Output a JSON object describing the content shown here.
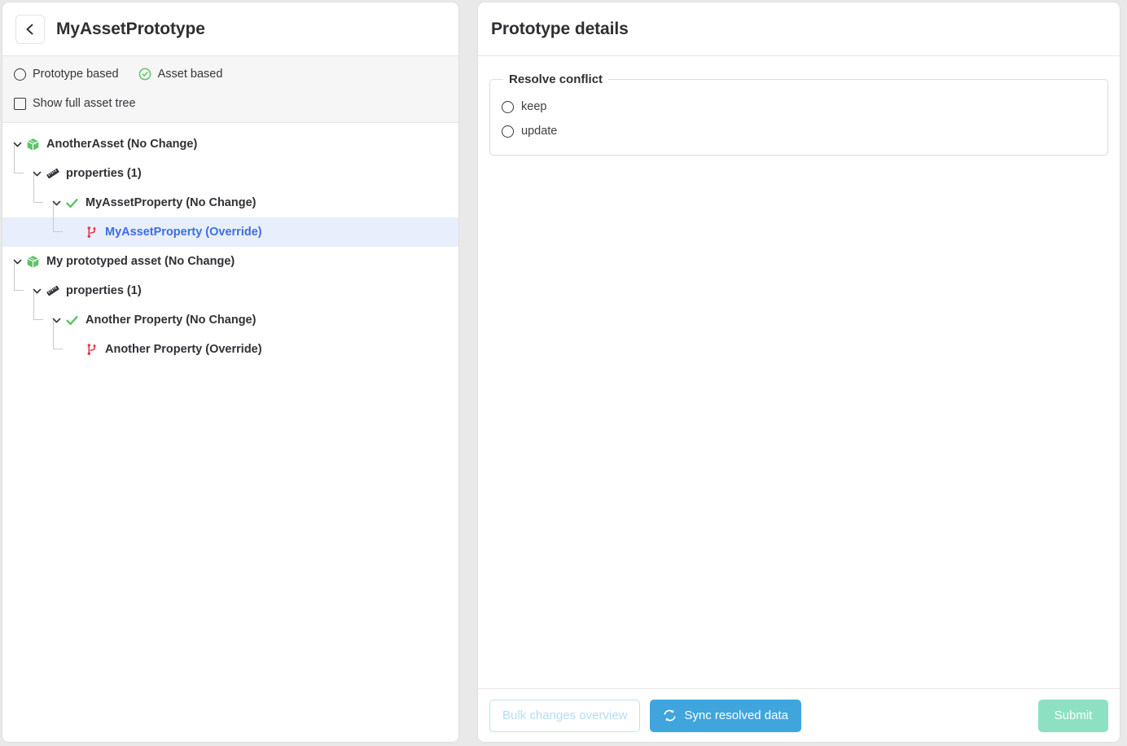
{
  "left_panel": {
    "back_button_icon": "chevron-left-icon",
    "title": "MyAssetPrototype",
    "toolbar": {
      "prototype_based_label": "Prototype based",
      "prototype_based_selected": false,
      "asset_based_label": "Asset based",
      "asset_based_selected": true,
      "show_full_asset_tree_label": "Show full asset tree",
      "show_full_asset_tree_checked": false
    },
    "tree": [
      {
        "label": "AnotherAsset (No Change)",
        "depth": 0,
        "icon": "green-cube-icon",
        "expanded": true,
        "selected": false
      },
      {
        "label": "properties (1)",
        "depth": 1,
        "icon": "ruler-icon",
        "expanded": true,
        "selected": false
      },
      {
        "label": "MyAssetProperty (No Change)",
        "depth": 2,
        "icon": "green-check-icon",
        "expanded": true,
        "selected": false
      },
      {
        "label": "MyAssetProperty (Override)",
        "depth": 3,
        "icon": "red-branch-icon",
        "expanded": null,
        "selected": true
      },
      {
        "label": "My prototyped asset (No Change)",
        "depth": 0,
        "icon": "green-cube-icon",
        "expanded": true,
        "selected": false
      },
      {
        "label": "properties (1)",
        "depth": 1,
        "icon": "ruler-icon",
        "expanded": true,
        "selected": false
      },
      {
        "label": "Another Property (No Change)",
        "depth": 2,
        "icon": "green-check-icon",
        "expanded": true,
        "selected": false
      },
      {
        "label": "Another Property (Override)",
        "depth": 3,
        "icon": "red-branch-icon",
        "expanded": null,
        "selected": false
      }
    ]
  },
  "right_panel": {
    "title": "Prototype details",
    "resolve_conflict": {
      "legend": "Resolve conflict",
      "options": [
        {
          "label": "keep",
          "selected": false
        },
        {
          "label": "update",
          "selected": false
        }
      ]
    },
    "footer": {
      "bulk_changes_label": "Bulk changes overview",
      "bulk_changes_disabled": true,
      "sync_label": "Sync resolved data",
      "sync_icon": "sync-icon",
      "submit_label": "Submit",
      "submit_disabled": true
    }
  },
  "colors": {
    "accent_blue": "#40a5dd",
    "submit_green": "#8ee0c2",
    "selected_row_bg": "#e8eefc",
    "selected_row_text": "#3d6ee0",
    "icon_green": "#5ec269",
    "icon_red": "#e8344a"
  }
}
